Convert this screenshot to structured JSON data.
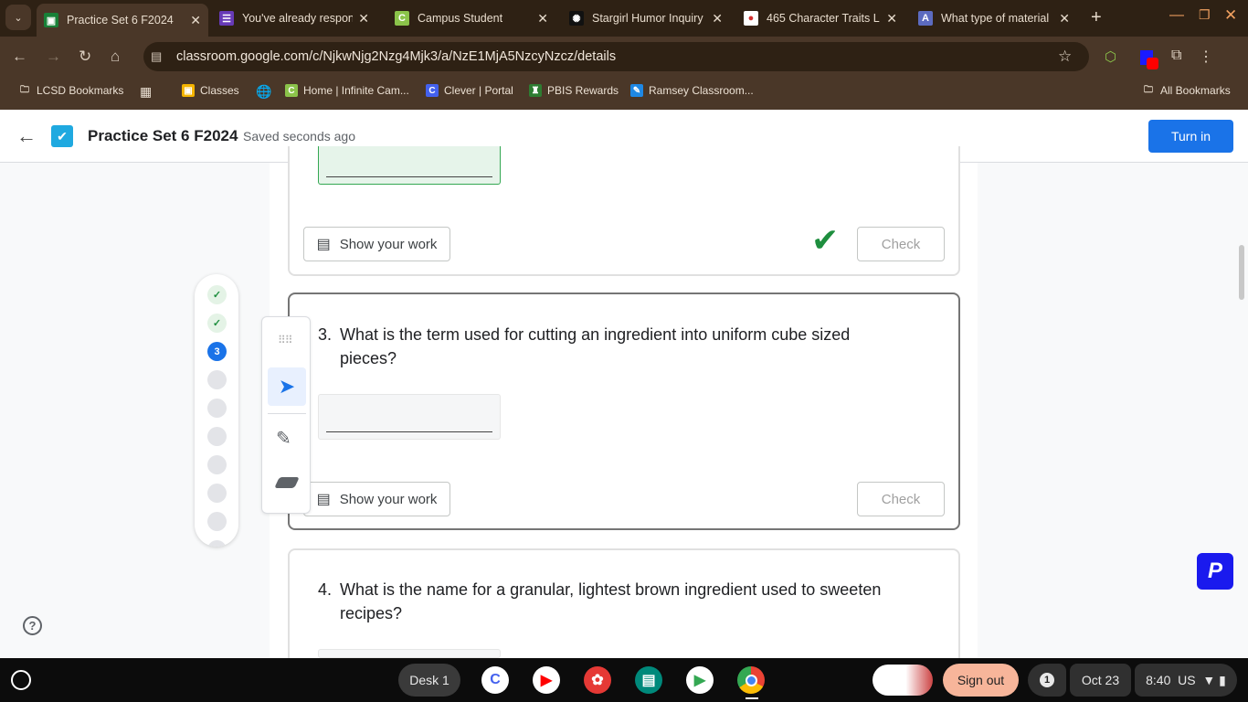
{
  "browser": {
    "tabs": [
      {
        "title": "Practice Set 6 F2024",
        "color": "#188038",
        "glyph": "▣",
        "active": true
      },
      {
        "title": "You've already respond",
        "color": "#673ab7",
        "glyph": "☰"
      },
      {
        "title": "Campus Student",
        "color": "#8bc34a",
        "glyph": "C"
      },
      {
        "title": "Stargirl Humor Inquiry",
        "color": "#111111",
        "glyph": "✺"
      },
      {
        "title": "465 Character Traits L",
        "color": "#ffffff",
        "glyph": "🍎"
      },
      {
        "title": "What type of material",
        "color": "#5c6bc0",
        "glyph": "A"
      }
    ],
    "url": "classroom.google.com/c/NjkwNjg2Nzg4Mjk3/a/NzE1MjA5NzcyNzcz/details",
    "bookmarks": [
      {
        "label": "LCSD Bookmarks",
        "icon": "folder-gear-icon"
      },
      {
        "label": "Classes",
        "color": "#f4b400",
        "glyph": "▣"
      },
      {
        "label": "Home | Infinite Cam...",
        "color": "#8bc34a",
        "glyph": "C"
      },
      {
        "label": "Clever | Portal",
        "color": "#4361ee",
        "glyph": "C"
      },
      {
        "label": "PBIS Rewards",
        "color": "#2e7d32",
        "glyph": "♜"
      },
      {
        "label": "Ramsey Classroom...",
        "color": "#1e88e5",
        "glyph": "✎"
      }
    ],
    "all_bookmarks": "All Bookmarks"
  },
  "header": {
    "title": "Practice Set 6 F2024",
    "status": "Saved seconds ago",
    "turn_in": "Turn in",
    "accent": "#1a73e8"
  },
  "questions": [
    {
      "number": "3.",
      "text": "What is the term used for cutting an ingredient into uniform cube sized pieces?",
      "answer": ""
    },
    {
      "number": "4.",
      "text": "What is the name for a granular, lightest brown ingredient used to sweeten recipes?",
      "answer": ""
    }
  ],
  "buttons": {
    "show_work": "Show your work",
    "check": "Check"
  },
  "progress": {
    "items": [
      "done",
      "done",
      "3",
      "",
      "",
      "",
      "",
      "",
      ""
    ],
    "current_label": "3"
  },
  "taskbar": {
    "desk": "Desk 1",
    "sign_out": "Sign out",
    "notifications": "1",
    "date": "Oct 23",
    "time": "8:40",
    "locale": "US"
  }
}
